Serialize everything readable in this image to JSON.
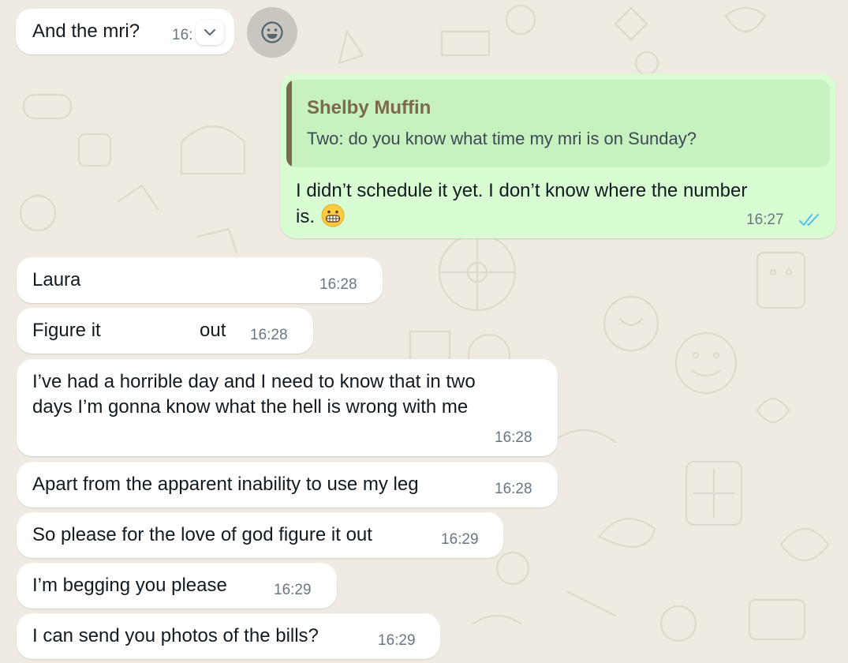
{
  "messages": [
    {
      "text": "And the mri?",
      "time": "16:"
    },
    {
      "quote_author": "Shelby Muffin",
      "quote_text": "Two: do you know what time my mri is on Sunday?",
      "line1": "I didn’t schedule it yet. I don’t know where the number",
      "line2": "is.",
      "emoji": "grimacing-face",
      "time": "16:27",
      "status": "read"
    },
    {
      "text": "Laura",
      "time": "16:28"
    },
    {
      "text_a": "Figure it",
      "text_b": "out",
      "time": "16:28"
    },
    {
      "line1": "I’ve had a horrible day and I need to know that in two",
      "line2": "days I’m gonna know what the hell is wrong with me",
      "time": "16:28"
    },
    {
      "text": "Apart from the apparent inability to use my leg",
      "time": "16:28"
    },
    {
      "text": "So please for the love of god figure it out",
      "time": "16:29"
    },
    {
      "text": "I’m begging you please",
      "time": "16:29"
    },
    {
      "text": "I can send you photos of the bills?",
      "time": "16:29"
    }
  ],
  "colors": {
    "background": "#efeae2",
    "incoming": "#ffffff",
    "outgoing": "#d9fdd3",
    "quote_bg": "#c7f1bf",
    "quote_author": "#7b6a4f",
    "read_ticks": "#53bdeb"
  },
  "icons": {
    "message_menu": "chevron-down-icon",
    "reaction": "smiley-face-icon",
    "read_receipt": "double-check-icon"
  }
}
